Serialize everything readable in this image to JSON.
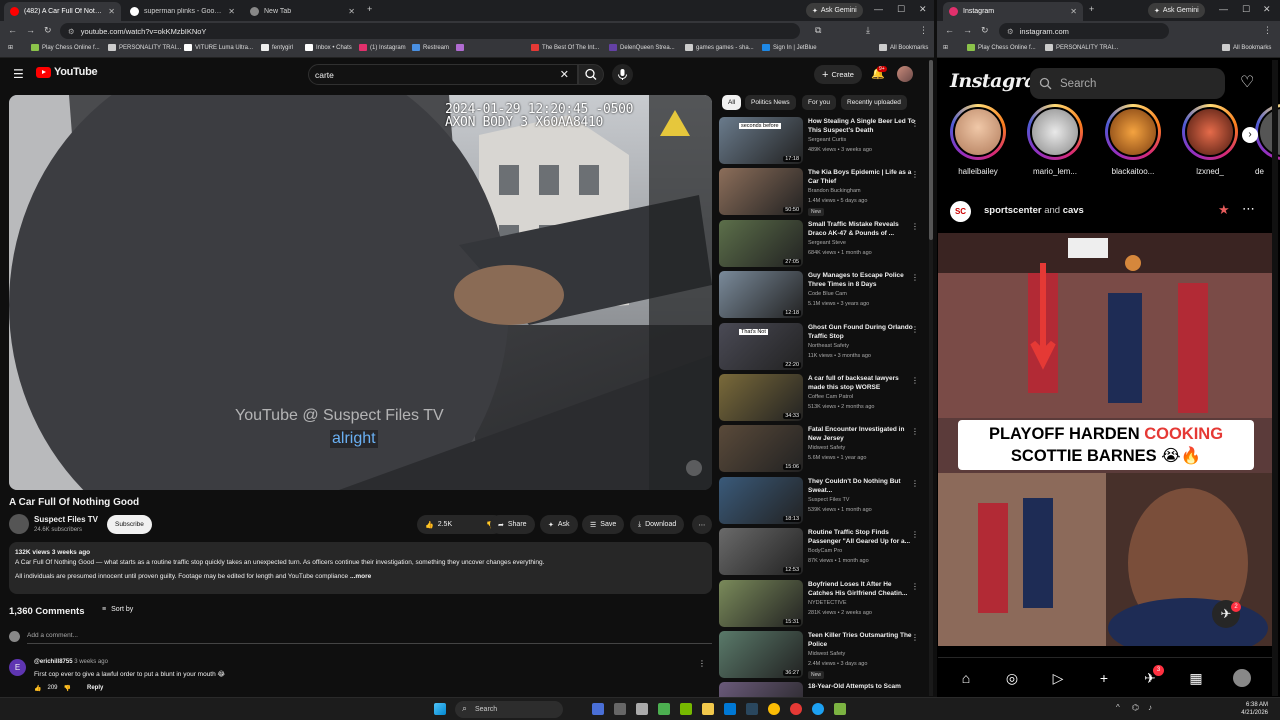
{
  "left_window": {
    "tabs": [
      {
        "label": "(482) A Car Full Of Nothing"
      },
      {
        "label": "superman plinks - Google Sear"
      },
      {
        "label": "New Tab"
      }
    ],
    "ask_gemini": "Ask Gemini",
    "url": "youtube.com/watch?v=okKMzbIKNoY",
    "bookmarks": [
      "Play Chess Online f...",
      "PERSONALITY TRAI...",
      "VITURE Luma Ultra...",
      "fentygirl",
      "Inbox • Chats",
      "(1) Instagram",
      "Restream",
      "",
      "The Best Of The Int...",
      "DelenQueen Strea...",
      "games games - sha...",
      "Sign In | JetBlue"
    ],
    "all_bookmarks": "All Bookmarks"
  },
  "youtube": {
    "logo": "YouTube",
    "search_value": "carte",
    "create_label": "Create",
    "notif_count": "9+",
    "video_timestamp_line1": "2024-01-29 12:20:45 -0500",
    "video_timestamp_line2": "AXON BODY 3 X60AA8410",
    "watermark": "YouTube @ Suspect Files TV",
    "caption": "alright",
    "title": "A Car Full Of Nothing Good",
    "channel": "Suspect Files TV",
    "subscribers": "24.6K subscribers",
    "subscribe": "Subscribe",
    "likes": "2.5K",
    "share": "Share",
    "ask": "Ask",
    "save": "Save",
    "download": "Download",
    "desc_meta": "132K views  3 weeks ago",
    "desc_line1": "A Car Full Of Nothing Good — what starts as a routine traffic stop quickly takes an unexpected turn. As officers continue their investigation, something they uncover changes everything.",
    "desc_line2": "All individuals are presumed innocent until proven guilty. Footage may be edited for length and YouTube compliance",
    "desc_more": "...more",
    "comments_count": "1,360 Comments",
    "sort_by": "Sort by",
    "add_comment": "Add a comment...",
    "comment": {
      "avatar_letter": "E",
      "author": "@erichill8755",
      "time": "3 weeks ago",
      "text": "First cop ever to give a lawful order to put a blunt in your mouth 😂",
      "likes": "209",
      "reply": "Reply"
    },
    "chips": [
      "All",
      "Politics News",
      "For you",
      "Recently uploaded"
    ],
    "related": [
      {
        "title": "How Stealing A Single Beer Led To This Suspect's Death",
        "channel": "Sergeant Curtis",
        "meta": "489K views • 3 weeks ago",
        "duration": "17:18",
        "thumb_text": "seconds before",
        "new": ""
      },
      {
        "title": "The Kia Boys Epidemic | Life as a Car Thief",
        "channel": "Brandon Buckingham",
        "meta": "1.4M views • 5 days ago",
        "duration": "50:50",
        "thumb_text": "",
        "new": "New"
      },
      {
        "title": "Small Traffic Mistake Reveals Draco AK-47 & Pounds of ...",
        "channel": "Sergeant Steve",
        "meta": "684K views • 1 month ago",
        "duration": "27:05",
        "thumb_text": "",
        "new": ""
      },
      {
        "title": "Guy Manages to Escape Police Three Times in 8 Days",
        "channel": "Code Blue Cam",
        "meta": "5.1M views • 3 years ago",
        "duration": "12:18",
        "thumb_text": "",
        "new": ""
      },
      {
        "title": "Ghost Gun Found During Orlando Traffic Stop",
        "channel": "Northeast Safety",
        "meta": "11K views • 3 months ago",
        "duration": "22:20",
        "thumb_text": "That's Not",
        "new": ""
      },
      {
        "title": "A car full of backseat lawyers made this stop WORSE",
        "channel": "Coffee Cam Patrol",
        "meta": "513K views • 2 months ago",
        "duration": "34:33",
        "thumb_text": "",
        "new": ""
      },
      {
        "title": "Fatal Encounter Investigated in New Jersey",
        "channel": "Midwest Safety",
        "meta": "5.6M views • 1 year ago",
        "duration": "15:06",
        "thumb_text": "",
        "new": ""
      },
      {
        "title": "They Couldn't Do Nothing But Sweat...",
        "channel": "Suspect Files TV",
        "meta": "539K views • 1 month ago",
        "duration": "18:13",
        "thumb_text": "",
        "new": ""
      },
      {
        "title": "Routine Traffic Stop Finds Passenger \"All Geared Up for a...",
        "channel": "BodyCam Pro",
        "meta": "87K views • 1 month ago",
        "duration": "12:53",
        "thumb_text": "",
        "new": ""
      },
      {
        "title": "Boyfriend Loses It After He Catches His Girlfriend Cheatin...",
        "channel": "NYDETECTIVE",
        "meta": "281K views • 2 weeks ago",
        "duration": "15:31",
        "thumb_text": "",
        "new": ""
      },
      {
        "title": "Teen Killer Tries Outsmarting The Police",
        "channel": "Midwest Safety",
        "meta": "2.4M views • 3 days ago",
        "duration": "36:27",
        "thumb_text": "",
        "new": "New"
      },
      {
        "title": "18-Year-Old Attempts to Scam",
        "channel": "",
        "meta": "",
        "duration": "",
        "thumb_text": "",
        "new": ""
      }
    ]
  },
  "right_window": {
    "tab_label": "Instagram",
    "ask_gemini": "Ask Gemini",
    "url": "instagram.com",
    "bookmarks": [
      "Play Chess Online f...",
      "PERSONALITY TRAI..."
    ],
    "all_bookmarks": "All Bookmarks"
  },
  "instagram": {
    "logo": "Instagram",
    "search_placeholder": "Search",
    "stories": [
      "halleibailey",
      "mario_lem...",
      "blackaitoo...",
      "lzxned_",
      "de"
    ],
    "post_author": "sportscenter",
    "post_and": "and",
    "post_coauthor": "cavs",
    "post_headline_1": "PLAYOFF HARDEN",
    "post_headline_cooking": "COOKING",
    "post_headline_2": "SCOTTIE BARNES 😭🔥",
    "activity_badge": "2",
    "nav_badge": "3"
  },
  "taskbar": {
    "search": "Search",
    "time": "6:38 AM",
    "date": "4/21/2026"
  }
}
